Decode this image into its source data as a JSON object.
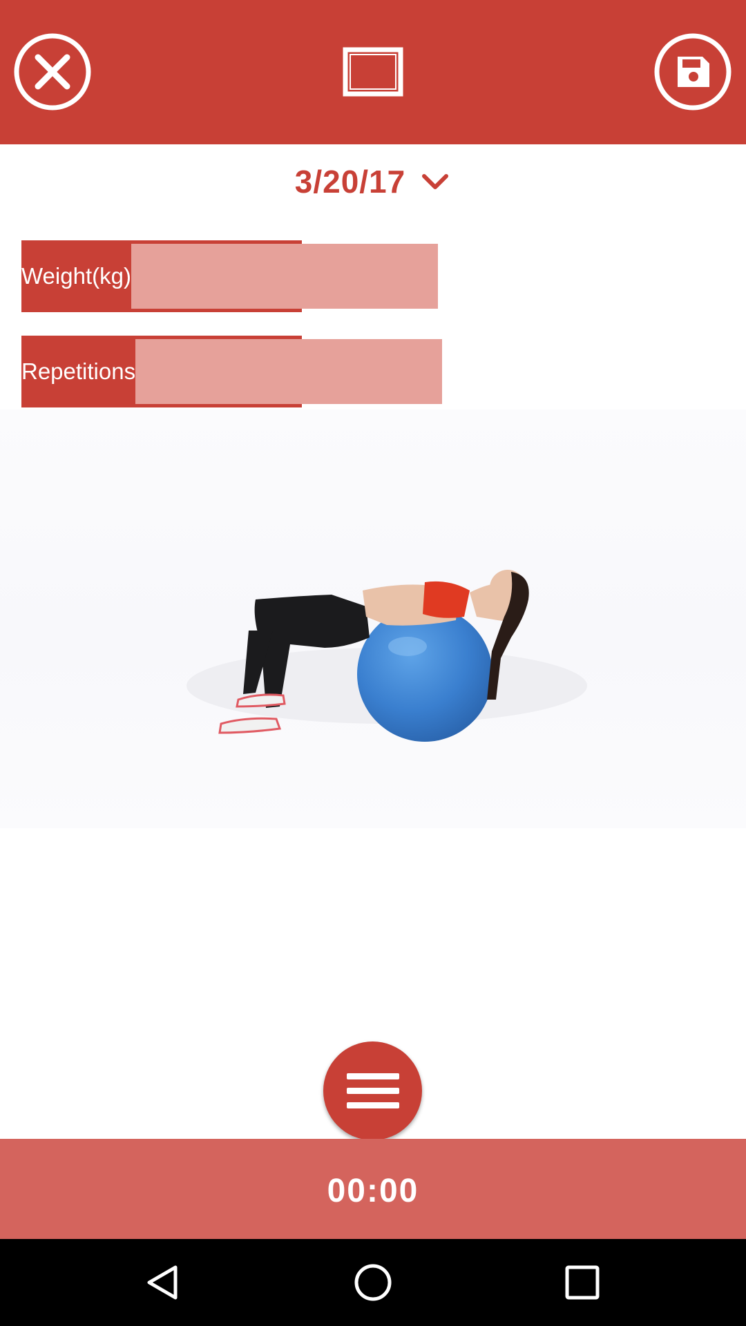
{
  "colors": {
    "primary": "#c84036",
    "primary_light": "#e6a19a",
    "timer_bar": "#d4645d",
    "white": "#ffffff",
    "navbar": "#000000"
  },
  "toolbar": {
    "close_icon": "close-circle-icon",
    "view_icon": "rectangle-view-icon",
    "save_icon": "save-floppy-icon"
  },
  "date_selector": {
    "value": "3/20/17",
    "icon": "chevron-down-icon"
  },
  "fields": {
    "weight": {
      "label": "Weight(kg)",
      "value": ""
    },
    "repetitions": {
      "label": "Repetitions",
      "value": ""
    }
  },
  "exercise_image": {
    "subject": "exercise-ball-crunch-illustration"
  },
  "menu_button": {
    "icon": "menu-hamburger-icon"
  },
  "timer": {
    "value": "00:00"
  },
  "system_nav": {
    "back_icon": "back-triangle-icon",
    "home_icon": "home-circle-icon",
    "recent_icon": "recent-apps-square-icon"
  }
}
